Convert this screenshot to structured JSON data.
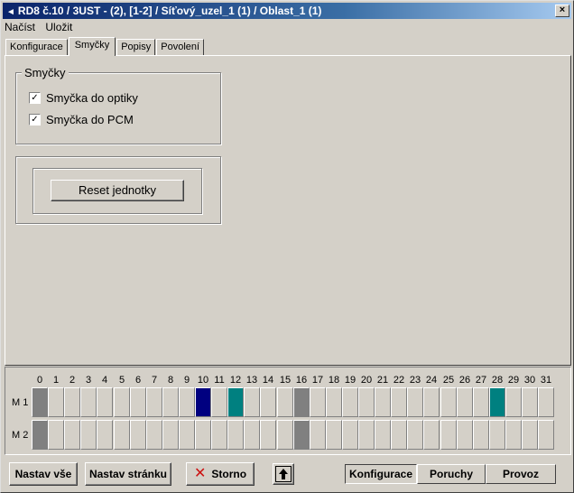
{
  "window": {
    "title": "RD8 č.10 / 3UST - (2), [1-2] / Síťový_uzel_1 (1) / Oblast_1 (1)",
    "close": "×",
    "title_icon": "◄"
  },
  "menu": [
    "Načíst",
    "Uložit"
  ],
  "tabs": [
    {
      "label": "Konfigurace",
      "active": false
    },
    {
      "label": "Smyčky",
      "active": true
    },
    {
      "label": "Popisy",
      "active": false
    },
    {
      "label": "Povolení",
      "active": false
    }
  ],
  "loops_group": {
    "title": "Smyčky",
    "checkboxes": [
      {
        "label": "Smyčka do optiky",
        "checked": true
      },
      {
        "label": "Smyčka do PCM",
        "checked": true
      }
    ]
  },
  "reset_button": "Reset jednotky",
  "grid": {
    "columns": [
      "0",
      "1",
      "2",
      "3",
      "4",
      "5",
      "6",
      "7",
      "8",
      "9",
      "10",
      "11",
      "12",
      "13",
      "14",
      "15",
      "16",
      "17",
      "18",
      "19",
      "20",
      "21",
      "22",
      "23",
      "24",
      "25",
      "26",
      "27",
      "28",
      "29",
      "30",
      "31"
    ],
    "rows": [
      {
        "label": "M 1",
        "colored": {
          "0": "grey",
          "10": "navy",
          "12": "teal",
          "16": "grey",
          "28": "teal"
        }
      },
      {
        "label": "M 2",
        "colored": {
          "0": "grey",
          "16": "grey"
        }
      }
    ],
    "colors": {
      "grey": "#808080",
      "navy": "#000080",
      "teal": "#008080"
    }
  },
  "bottom": {
    "set_all": "Nastav vše",
    "set_page": "Nastav stránku",
    "cancel": "Storno",
    "up_icon": "up-arrow-icon",
    "modes": [
      {
        "label": "Konfigurace",
        "pressed": true
      },
      {
        "label": "Poruchy",
        "pressed": false
      },
      {
        "label": "Provoz",
        "pressed": false
      }
    ]
  }
}
